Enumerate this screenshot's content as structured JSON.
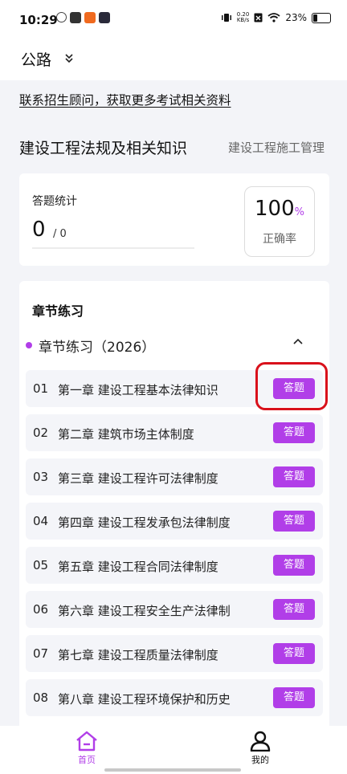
{
  "status_bar": {
    "time": "10:29",
    "net_speed_value": "0.20",
    "net_speed_unit": "KB/s",
    "battery_percent": "23%",
    "notification_icons": [
      "swirl-app-icon",
      "mail-app-icon",
      "orange-app-icon",
      "play-app-icon"
    ],
    "notification_colors": [
      "#444444",
      "#333333",
      "#f06a1f",
      "#2a2a3a"
    ]
  },
  "header": {
    "title": "公路",
    "chevron": "⌄⌄"
  },
  "promo_link": "联系招生顾问，获取更多考试相关资料",
  "subject": {
    "title": "建设工程法规及相关知识",
    "alt_subject": "建设工程施工管理"
  },
  "stats": {
    "label": "答题统计",
    "answered": "0",
    "total": "/ 0",
    "rate_value": "100",
    "rate_unit": "%",
    "rate_label": "正确率"
  },
  "chapters": {
    "title": "章节练习",
    "group_label": "章节练习（2026）",
    "collapse_icon": "^",
    "answer_label": "答题",
    "accent_color": "#b13ee8",
    "highlight_color": "#d9111b",
    "items": [
      {
        "num": "01",
        "name": "第一章 建设工程基本法律知识"
      },
      {
        "num": "02",
        "name": "第二章 建筑市场主体制度"
      },
      {
        "num": "03",
        "name": "第三章 建设工程许可法律制度"
      },
      {
        "num": "04",
        "name": "第四章 建设工程发承包法律制度"
      },
      {
        "num": "05",
        "name": "第五章 建设工程合同法律制度"
      },
      {
        "num": "06",
        "name": "第六章 建设工程安全生产法律制"
      },
      {
        "num": "07",
        "name": "第七章 建设工程质量法律制度"
      },
      {
        "num": "08",
        "name": "第八章 建设工程环境保护和历史"
      }
    ]
  },
  "bottom_nav": {
    "home_label": "首页",
    "mine_label": "我的",
    "home_color": "#b13ee8"
  }
}
